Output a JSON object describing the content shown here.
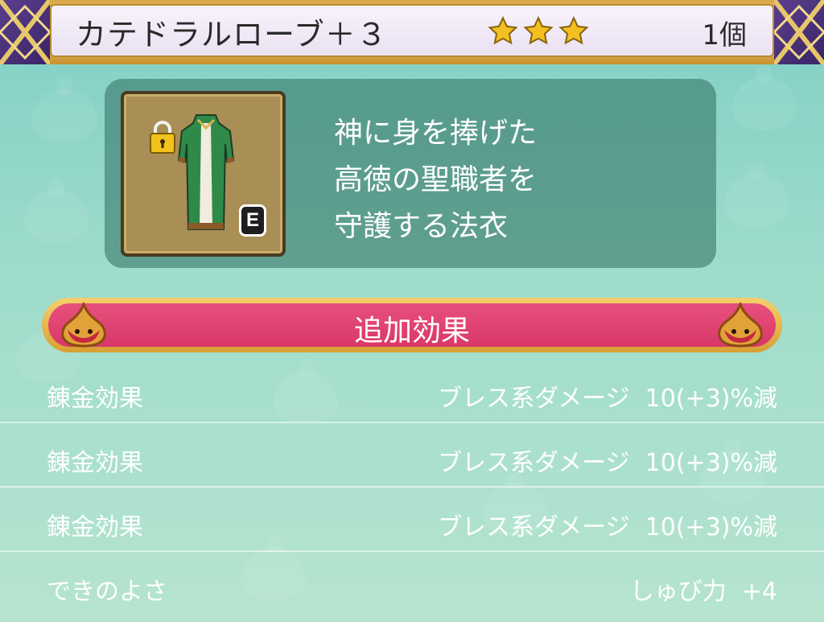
{
  "header": {
    "item_name": "カテドラルローブ＋３",
    "star_count": 3,
    "quantity": "1個"
  },
  "item": {
    "icon": "green-robe-icon",
    "locked": true,
    "equipped_badge": "E",
    "description": "神に身を捧げた\n高徳の聖職者を\n守護する法衣"
  },
  "effects": {
    "title": "追加効果",
    "rows": [
      {
        "label": "錬金効果",
        "value": "ブレス系ダメージ  10(+3)%減"
      },
      {
        "label": "錬金効果",
        "value": "ブレス系ダメージ  10(+3)%減"
      },
      {
        "label": "錬金効果",
        "value": "ブレス系ダメージ  10(+3)%減"
      },
      {
        "label": "できのよさ",
        "value": "しゅび力  +4"
      }
    ]
  },
  "colors": {
    "header_border": "#d9a84a",
    "corner": "#5b3f8e",
    "banner": "#e8507c",
    "star": "#f4c021",
    "background": "#9fdccc"
  }
}
